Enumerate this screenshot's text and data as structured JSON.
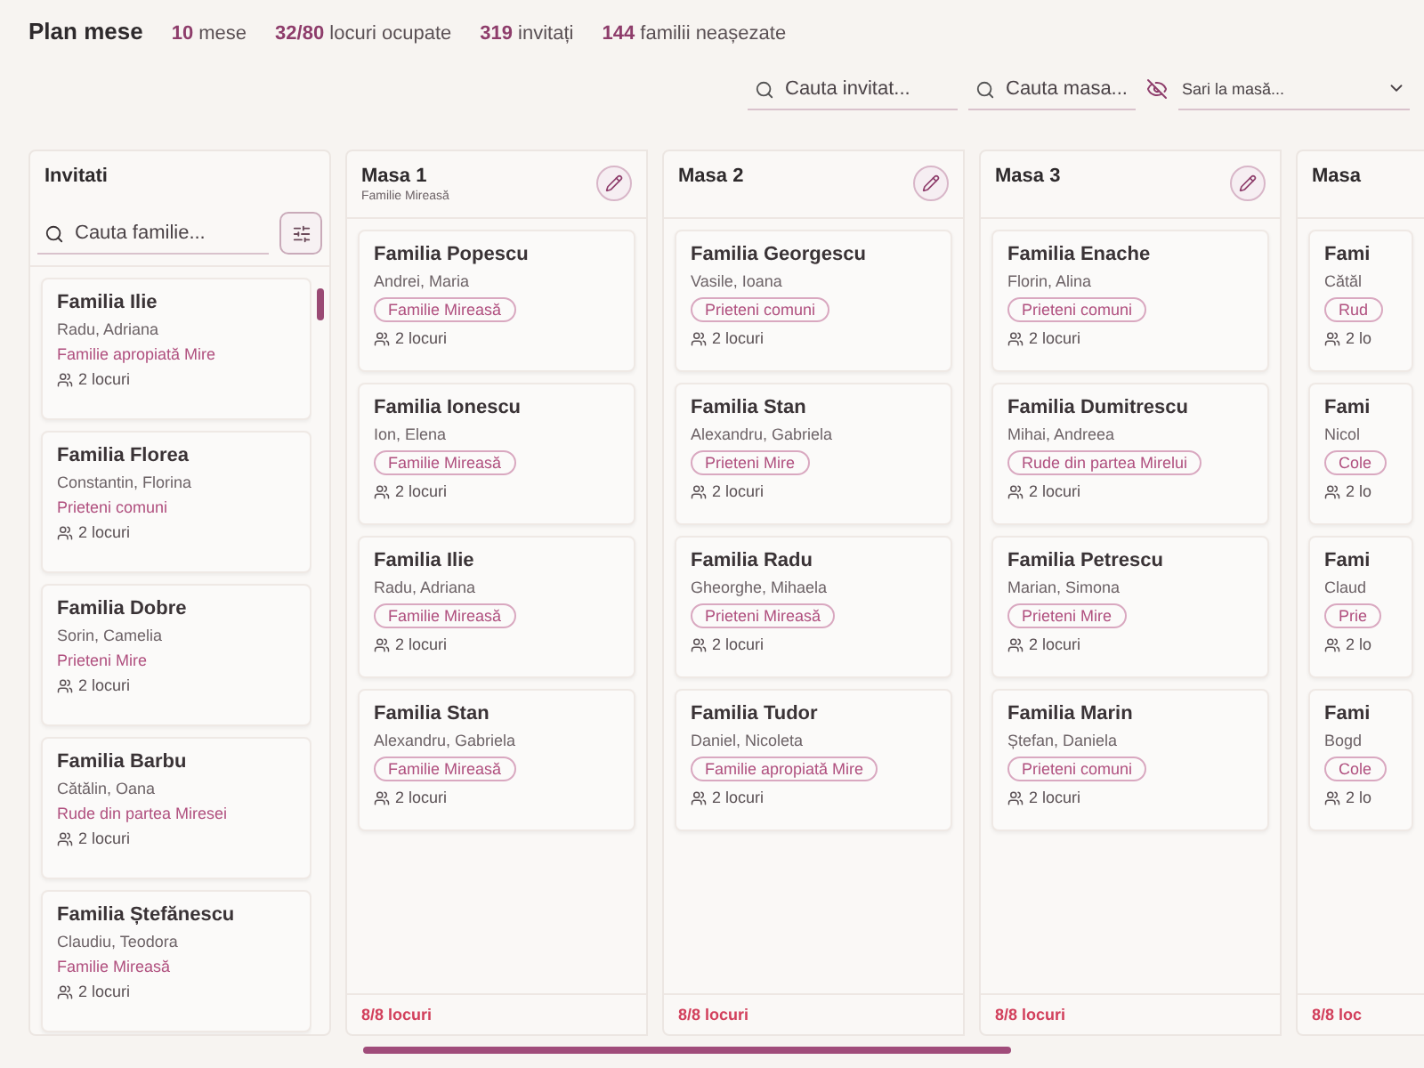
{
  "header": {
    "title": "Plan mese",
    "stats": [
      "**10** mese",
      "**32/80** locuri ocupate",
      "**319** invitați",
      "**144** familii neașezate"
    ]
  },
  "toolbar": {
    "guest_search": {
      "placeholder": "Cauta invitat..."
    },
    "table_search": {
      "placeholder": "Cauta masa..."
    },
    "jump_select": {
      "placeholder": "Sari la masă..."
    }
  },
  "guests_panel": {
    "title": "Invitati",
    "search": {
      "placeholder": "Cauta familie..."
    },
    "families": [
      {
        "name": "Familia Ilie",
        "members": "Radu, Adriana",
        "group": "Familie apropiată Mire",
        "seats": "2 locuri"
      },
      {
        "name": "Familia Florea",
        "members": "Constantin, Florina",
        "group": "Prieteni comuni",
        "seats": "2 locuri"
      },
      {
        "name": "Familia Dobre",
        "members": "Sorin, Camelia",
        "group": "Prieteni Mire",
        "seats": "2 locuri"
      },
      {
        "name": "Familia Barbu",
        "members": "Cătălin, Oana",
        "group": "Rude din partea Miresei",
        "seats": "2 locuri"
      },
      {
        "name": "Familia Ștefănescu",
        "members": "Claudiu, Teodora",
        "group": "Familie Mireasă",
        "seats": "2 locuri"
      }
    ]
  },
  "tables": [
    {
      "title": "Masa 1",
      "subtitle": "Familie Mireasă",
      "occupancy": "8/8 locuri",
      "partial": false,
      "families": [
        {
          "name": "Familia Popescu",
          "members": "Andrei, Maria",
          "group": "Familie Mireasă",
          "seats": "2 locuri"
        },
        {
          "name": "Familia Ionescu",
          "members": "Ion, Elena",
          "group": "Familie Mireasă",
          "seats": "2 locuri"
        },
        {
          "name": "Familia Ilie",
          "members": "Radu, Adriana",
          "group": "Familie Mireasă",
          "seats": "2 locuri"
        },
        {
          "name": "Familia Stan",
          "members": "Alexandru, Gabriela",
          "group": "Familie Mireasă",
          "seats": "2 locuri"
        }
      ]
    },
    {
      "title": "Masa 2",
      "occupancy": "8/8 locuri",
      "partial": false,
      "families": [
        {
          "name": "Familia Georgescu",
          "members": "Vasile, Ioana",
          "group": "Prieteni comuni",
          "seats": "2 locuri"
        },
        {
          "name": "Familia Stan",
          "members": "Alexandru, Gabriela",
          "group": "Prieteni Mire",
          "seats": "2 locuri"
        },
        {
          "name": "Familia Radu",
          "members": "Gheorghe, Mihaela",
          "group": "Prieteni Mireasă",
          "seats": "2 locuri"
        },
        {
          "name": "Familia Tudor",
          "members": "Daniel, Nicoleta",
          "group": "Familie apropiată Mire",
          "seats": "2 locuri"
        }
      ]
    },
    {
      "title": "Masa 3",
      "occupancy": "8/8 locuri",
      "partial": false,
      "families": [
        {
          "name": "Familia Enache",
          "members": "Florin, Alina",
          "group": "Prieteni comuni",
          "seats": "2 locuri"
        },
        {
          "name": "Familia Dumitrescu",
          "members": "Mihai, Andreea",
          "group": "Rude din partea Mirelui",
          "seats": "2 locuri"
        },
        {
          "name": "Familia Petrescu",
          "members": "Marian, Simona",
          "group": "Prieteni Mire",
          "seats": "2 locuri"
        },
        {
          "name": "Familia Marin",
          "members": "Ștefan, Daniela",
          "group": "Prieteni comuni",
          "seats": "2 locuri"
        }
      ]
    },
    {
      "title": "Masa",
      "occupancy": "8/8 loc",
      "partial": true,
      "families": [
        {
          "name": "Fami",
          "members": "Cătăl",
          "group": "Rud",
          "seats": "2 lo"
        },
        {
          "name": "Fami",
          "members": "Nicol",
          "group": "Cole",
          "seats": "2 lo"
        },
        {
          "name": "Fami",
          "members": "Claud",
          "group": "Prie",
          "seats": "2 lo"
        },
        {
          "name": "Fami",
          "members": "Bogd",
          "group": "Cole",
          "seats": "2 lo"
        }
      ]
    }
  ]
}
